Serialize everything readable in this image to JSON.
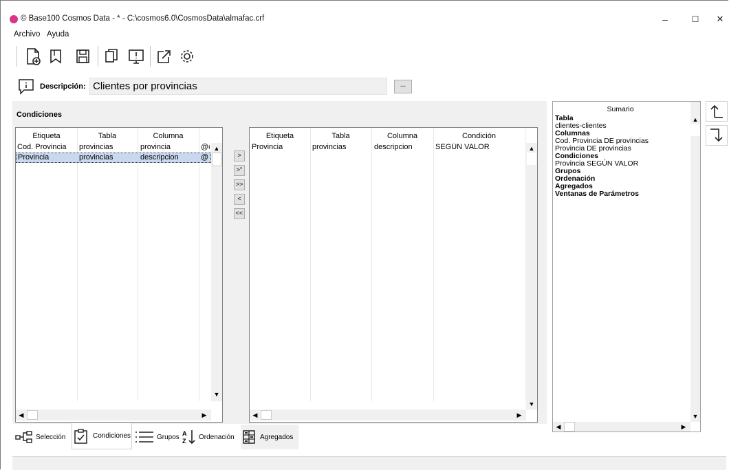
{
  "window": {
    "title": "© Base100 Cosmos Data - * - C:\\cosmos6.0\\CosmosData\\almafac.crf",
    "controls": {
      "minimize": "–",
      "maximize": "☐",
      "close": "✕"
    }
  },
  "menu": {
    "items": [
      "Archivo",
      "Ayuda"
    ]
  },
  "toolbar": {
    "icons": [
      "new-file-icon",
      "open-icon",
      "save-icon",
      "copy-icon",
      "preview-icon",
      "export-icon",
      "settings-icon"
    ]
  },
  "description": {
    "label": "Descripción:",
    "value": "Clientes por provincias",
    "browse": "..."
  },
  "conditions": {
    "heading": "Condiciones",
    "left_grid": {
      "headers": [
        "Etiqueta",
        "Tabla",
        "Columna"
      ],
      "rows": [
        [
          "Cod. Provincia",
          "provincias",
          "provincia",
          "@c"
        ],
        [
          "Provincia",
          "provincias",
          "descripcion",
          "@"
        ]
      ]
    },
    "move_buttons": [
      ">",
      ">\"",
      ">>",
      "<",
      "<<"
    ],
    "right_grid": {
      "headers": [
        "Etiqueta",
        "Tabla",
        "Columna",
        "Condición"
      ],
      "rows": [
        [
          "Provincia",
          "provincias",
          "descripcion",
          "SEGÚN VALOR"
        ]
      ]
    }
  },
  "summary": {
    "title": "Sumario",
    "lines": [
      {
        "text": "Tabla",
        "bold": true
      },
      {
        "text": "clientes-clientes",
        "bold": false
      },
      {
        "text": "Columnas",
        "bold": true
      },
      {
        "text": "Cod. Provincia DE provincias",
        "bold": false
      },
      {
        "text": "Provincia DE provincias",
        "bold": false
      },
      {
        "text": "Condiciones",
        "bold": true
      },
      {
        "text": "Provincia SEGÚN VALOR",
        "bold": false
      },
      {
        "text": "Grupos",
        "bold": true
      },
      {
        "text": "Ordenación",
        "bold": true
      },
      {
        "text": "Agregados",
        "bold": true
      },
      {
        "text": "Ventanas de Parámetros",
        "bold": true
      }
    ]
  },
  "tabs": {
    "items": [
      {
        "label": "Selección",
        "icon": "selection-icon"
      },
      {
        "label": "Condiciones",
        "icon": "clipboard-check-icon"
      },
      {
        "label": "Grupos",
        "icon": "list-icon"
      },
      {
        "label": "Ordenación",
        "icon": "sort-az-icon"
      },
      {
        "label": "Agregados",
        "icon": "aggregate-icon"
      }
    ],
    "active": "Condiciones"
  }
}
